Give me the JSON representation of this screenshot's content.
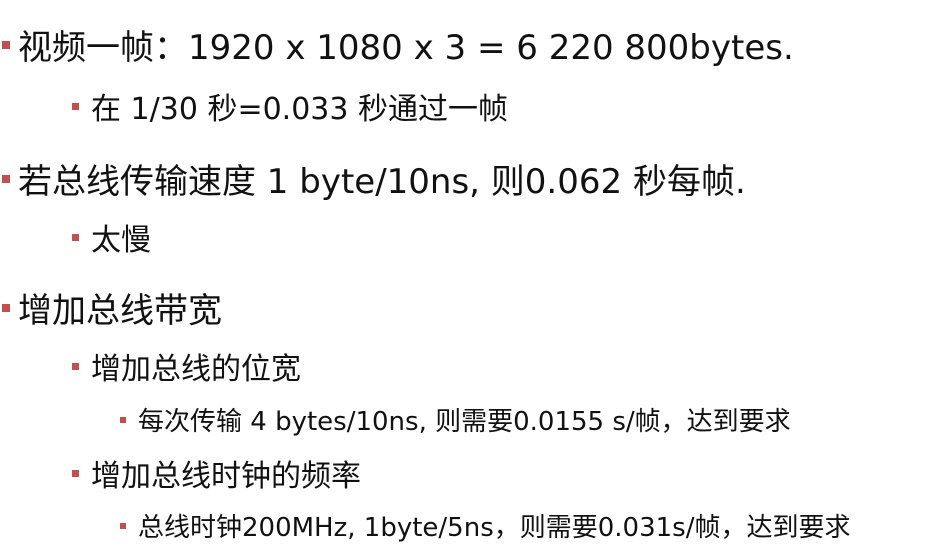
{
  "accent_color": "#c0504d",
  "bullets": [
    "视频一帧：1920 x 1080 x 3 = 6 220 800bytes.",
    "在 1/30 秒=0.033 秒通过一帧",
    "若总线传输速度 1 byte/10ns, 则0.062 秒每帧.",
    "太慢",
    "增加总线带宽",
    "增加总线的位宽",
    "每次传输 4 bytes/10ns, 则需要0.0155 s/帧，达到要求",
    "增加总线时钟的频率",
    "总线时钟200MHz, 1byte/5ns，则需要0.031s/帧，达到要求"
  ]
}
